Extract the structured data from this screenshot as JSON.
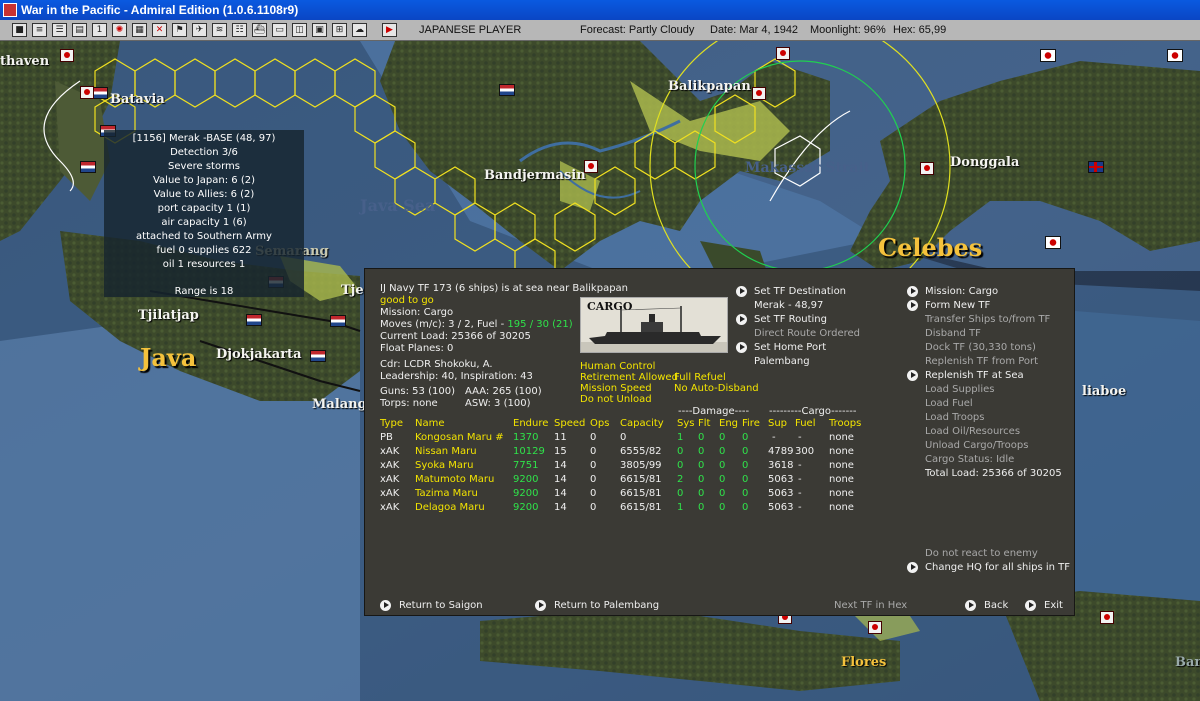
{
  "window": {
    "title": "War in the Pacific - Admiral Edition (1.0.6.1108r9)"
  },
  "toolbar": {
    "buttons": [
      "save-button",
      "report-button",
      "intel-button",
      "ship-button",
      "sun-button",
      "map-button",
      "arms-button",
      "lines-button",
      "flag-button",
      "air-button",
      "transit-button",
      "lists-button",
      "tf-button",
      "ops-button",
      "convoy-button",
      "hq-button",
      "play-button"
    ],
    "player": "JAPANESE PLAYER",
    "forecast": "Forecast: Partly Cloudy",
    "date": "Date: Mar 4, 1942",
    "moonlight": "Moonlight: 96%",
    "hex": "Hex: 65,99"
  },
  "map": {
    "places": {
      "thaven": "thaven",
      "batavia": "Batavia",
      "balikpapan": "Balikpapan",
      "bandjermasin": "Bandjermasin",
      "java_sea": "Java Sea",
      "makassar": "Makassar Strait",
      "donggala": "Donggala",
      "celebes": "Celebes",
      "semarang": "Semarang",
      "tjer": "Tjer",
      "tjilatjap": "Tjilatjap",
      "java": "Java",
      "djokjakarta": "Djokjakarta",
      "malang": "Malang",
      "liaboe": "liaboe",
      "flores": "Flores",
      "banda": "Band"
    }
  },
  "base_info": {
    "lines": [
      "[1156] Merak  -BASE (48, 97)",
      "Detection 3/6",
      "Severe storms",
      "Value to Japan:  6 (2)",
      "Value to Allies:  6 (2)",
      "port capacity 1 (1)",
      "air capacity 1 (6)",
      "attached to Southern Army",
      "fuel 0  supplies 622",
      "oil 1  resources 1",
      "Range is 18"
    ]
  },
  "tf": {
    "header": "IJ Navy TF 173 (6 ships) is at sea near Balikpapan",
    "status": "good to go",
    "mission": "Mission: Cargo",
    "moves_label": "Moves (m/c): 3 / 2, Fuel - ",
    "moves_fuel": "195 / 30 (21)",
    "current_load": "Current Load: 25366 of 30205",
    "float_planes": "Float Planes: 0",
    "cdr": "Cdr: LCDR  Shokoku, A.",
    "leadership": "Leadership: 40, Inspiration: 43",
    "guns": "Guns: 53 (100)",
    "torps": "Torps: none",
    "aaa": "AAA: 265 (100)",
    "asw": "ASW: 3 (100)",
    "picture_label": "CARGO",
    "options": {
      "human_control": "Human Control",
      "retirement": "Retirement Allowed",
      "mission_speed": "Mission Speed",
      "do_not_unload": "Do not Unload",
      "full_refuel": "Full Refuel",
      "no_auto_disband": "No Auto-Disband"
    },
    "mid_menu": {
      "set_destination": "Set TF Destination",
      "destination": "Merak - 48,97",
      "set_routing": "Set TF Routing",
      "direct_route": "Direct Route Ordered",
      "set_home": "Set Home Port",
      "home_port": "Palembang"
    },
    "right_menu": [
      {
        "label": "Mission: Cargo",
        "style": "w",
        "arrow": true
      },
      {
        "label": "Form New TF",
        "style": "w",
        "arrow": true
      },
      {
        "label": "Transfer Ships to/from TF",
        "style": "d",
        "arrow": false
      },
      {
        "label": "Disband TF",
        "style": "d",
        "arrow": false
      },
      {
        "label": "Dock TF (30,330 tons)",
        "style": "d",
        "arrow": false
      },
      {
        "label": "Replenish TF from Port",
        "style": "d",
        "arrow": false
      },
      {
        "label": "Replenish TF at Sea",
        "style": "w",
        "arrow": true
      },
      {
        "label": "Load Supplies",
        "style": "d",
        "arrow": false
      },
      {
        "label": "Load Fuel",
        "style": "d",
        "arrow": false
      },
      {
        "label": "Load Troops",
        "style": "d",
        "arrow": false
      },
      {
        "label": "Load Oil/Resources",
        "style": "d",
        "arrow": false
      },
      {
        "label": "Unload Cargo/Troops",
        "style": "d",
        "arrow": false
      },
      {
        "label": "Cargo Status: Idle",
        "style": "d",
        "arrow": false
      },
      {
        "label": "Total Load: 25366 of 30205",
        "style": "w",
        "arrow": false
      }
    ],
    "no_react": "Do not react to enemy",
    "change_hq": "Change HQ for all ships in TF",
    "group_headers": {
      "damage": "----Damage----",
      "cargo": "---------Cargo-------"
    },
    "columns": {
      "type": "Type",
      "name": "Name",
      "endure": "Endure",
      "speed": "Speed",
      "ops": "Ops",
      "capacity": "Capacity",
      "sys": "Sys",
      "flt": "Flt",
      "eng": "Eng",
      "fire": "Fire",
      "sup": "Sup",
      "fuel": "Fuel",
      "troops": "Troops"
    },
    "ships": [
      {
        "type": "PB",
        "name": "Kongosan Maru #",
        "endure": "1370",
        "speed": "11",
        "ops": "0",
        "capacity": "0",
        "sys": "1",
        "flt": "0",
        "eng": "0",
        "fire": "0",
        "sup": "-",
        "fuel": "-",
        "troops": "none"
      },
      {
        "type": "xAK",
        "name": "Nissan Maru",
        "endure": "10129",
        "speed": "15",
        "ops": "0",
        "capacity": "6555/82",
        "sys": "0",
        "flt": "0",
        "eng": "0",
        "fire": "0",
        "sup": "4789",
        "fuel": "300",
        "troops": "none"
      },
      {
        "type": "xAK",
        "name": "Syoka Maru",
        "endure": "7751",
        "speed": "14",
        "ops": "0",
        "capacity": "3805/99",
        "sys": "0",
        "flt": "0",
        "eng": "0",
        "fire": "0",
        "sup": "3618",
        "fuel": "-",
        "troops": "none"
      },
      {
        "type": "xAK",
        "name": "Matumoto Maru",
        "endure": "9200",
        "speed": "14",
        "ops": "0",
        "capacity": "6615/81",
        "sys": "2",
        "flt": "0",
        "eng": "0",
        "fire": "0",
        "sup": "5063",
        "fuel": "-",
        "troops": "none"
      },
      {
        "type": "xAK",
        "name": "Tazima Maru",
        "endure": "9200",
        "speed": "14",
        "ops": "0",
        "capacity": "6615/81",
        "sys": "0",
        "flt": "0",
        "eng": "0",
        "fire": "0",
        "sup": "5063",
        "fuel": "-",
        "troops": "none"
      },
      {
        "type": "xAK",
        "name": "Delagoa Maru",
        "endure": "9200",
        "speed": "14",
        "ops": "0",
        "capacity": "6615/81",
        "sys": "1",
        "flt": "0",
        "eng": "0",
        "fire": "0",
        "sup": "5063",
        "fuel": "-",
        "troops": "none"
      }
    ],
    "footer": {
      "return_saigon": "Return to Saigon",
      "return_palembang": "Return to Palembang",
      "next_tf": "Next TF in Hex",
      "back": "Back",
      "exit": "Exit"
    }
  },
  "colors": {
    "accent_yellow": "#f3e400",
    "accent_green": "#2fe24a",
    "panel_bg": "#3b3a35",
    "titlebar": "#0a52d6"
  }
}
